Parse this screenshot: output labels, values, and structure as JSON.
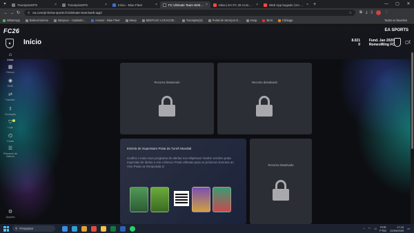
{
  "browser": {
    "tabs": [
      {
        "label": "TracsipiraGPS",
        "active": false
      },
      {
        "label": "TracsipiraGPS",
        "active": false
      },
      {
        "label": "Início - Blue Fleet",
        "active": false
      },
      {
        "label": "FC Ultimate Team Web App - E",
        "active": true
      },
      {
        "label": "Ideia | EA FC 26 Community Su",
        "active": false
      },
      {
        "label": "Web App bugado | EA Forum",
        "active": false
      }
    ],
    "url": "ea.com/pt-br/ea-sports-fc/ultimate-team/web-app/",
    "bookmarks": [
      "WhatsApp",
      "Bolecommerce",
      "BeepLoc - Cadastro...",
      "Acesso - Blue Fleet",
      "Meep",
      "BEEPLOC LOCACOE...",
      "Tracsipira(1t)",
      "Portal de Serviços G...",
      "Hoop",
      "Brnit",
      "Clickage"
    ],
    "all_bookmarks": "Todos os favoritos"
  },
  "app": {
    "brand": "FC26",
    "publisher": "EA SPORTS",
    "page_title": "Início",
    "coins": "8.021",
    "points": "0",
    "club_date": "Fund. Jan 2020",
    "club_name": "RomeoWing FC",
    "notifications": "0"
  },
  "sidebar": [
    {
      "label": "Início",
      "icon": "home-icon",
      "glyph": "⌂",
      "active": true
    },
    {
      "label": "Elenco",
      "icon": "squad-icon",
      "glyph": "▦",
      "active": false
    },
    {
      "label": "DME",
      "icon": "sbc-icon",
      "glyph": "◉",
      "active": false
    },
    {
      "label": "Transfer.",
      "icon": "transfer-icon",
      "glyph": "⇄",
      "active": false
    },
    {
      "label": "Evolução",
      "icon": "evolution-icon",
      "glyph": "⇧",
      "active": false
    },
    {
      "label": "Loja",
      "icon": "store-icon",
      "glyph": "⛉",
      "active": false
    },
    {
      "label": "Clube",
      "icon": "club-icon",
      "glyph": "⌬",
      "active": false
    },
    {
      "label": "Placares de líderes",
      "icon": "leaderboard-icon",
      "glyph": "☰",
      "active": false
    }
  ],
  "sidebar_bottom": {
    "label": "Opções",
    "glyph": "⚙"
  },
  "tiles": {
    "locked_label": "Recurso desativado"
  },
  "promo": {
    "title": "Estrela de Superstars Prata da Turnê Mundial",
    "description": "Confira o mais novo programa de alertas nos Objetivos! Ganhe versões prata especiais de ídolos e crie o Elenco Prata Ultimate para os próximos Eventos ao Vivo Prata na Temporada 1!"
  },
  "taskbar": {
    "search_placeholder": "Pesquisar",
    "lang": "POR",
    "lang2": "PTB2",
    "time": "17:10",
    "date": "22/09/2025"
  }
}
